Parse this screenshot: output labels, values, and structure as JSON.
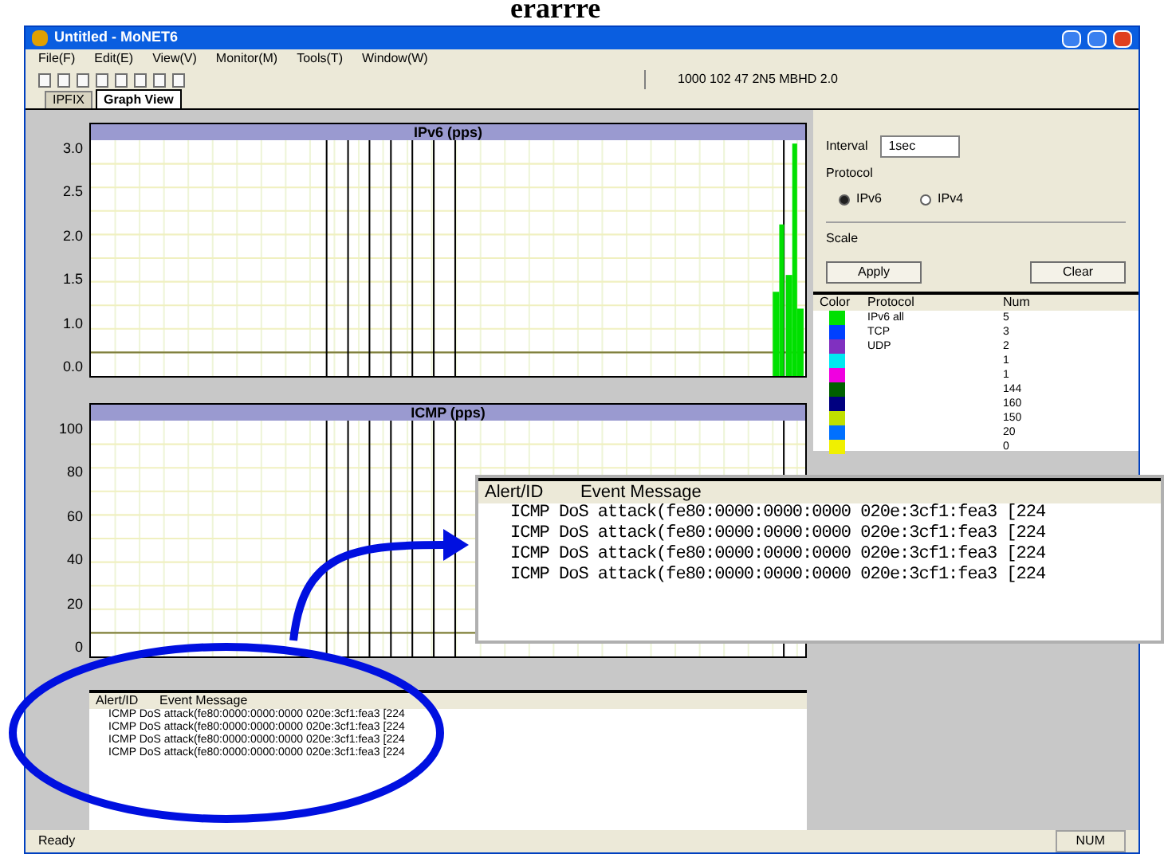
{
  "heading": "erarrre",
  "window": {
    "title": "Untitled - MoNET6"
  },
  "menu": [
    "File(F)",
    "Edit(E)",
    "View(V)",
    "Monitor(M)",
    "Tools(T)",
    "Window(W)"
  ],
  "toolbar": {
    "status_text": "1000  102  47  2N5  MBHD  2.0"
  },
  "tabs": [
    {
      "label": "IPFIX",
      "selected": false
    },
    {
      "label": "Graph View",
      "selected": true
    }
  ],
  "charts": [
    {
      "title": "IPv6 (pps)",
      "y_labels": [
        "3.0",
        "2.5",
        "2.0",
        "1.5",
        "1.0",
        "0.0"
      ],
      "burst": true
    },
    {
      "title": "ICMP (pps)",
      "y_labels": [
        "100",
        "80",
        "60",
        "40",
        "20",
        "0"
      ],
      "burst": false
    }
  ],
  "settings": {
    "interval_label": "Interval",
    "interval_value": "1sec",
    "protocol_label": "Protocol",
    "radios": [
      {
        "label": "IPv6",
        "selected": true
      },
      {
        "label": "IPv4",
        "selected": false
      }
    ],
    "scale_label": "Scale",
    "buttons": [
      "Apply",
      "Clear"
    ]
  },
  "legend": {
    "columns": [
      "Color",
      "Protocol",
      "Num"
    ],
    "rows": [
      {
        "color": "#00e000",
        "protocol": "IPv6 all",
        "num": "5"
      },
      {
        "color": "#0040ff",
        "protocol": "TCP",
        "num": "3"
      },
      {
        "color": "#8030c0",
        "protocol": "UDP",
        "num": "2"
      },
      {
        "color": "#00e8f0",
        "protocol": "",
        "num": "1"
      },
      {
        "color": "#f000e0",
        "protocol": "",
        "num": "1"
      },
      {
        "color": "#006000",
        "protocol": "",
        "num": "144"
      },
      {
        "color": "#000080",
        "protocol": "",
        "num": "160"
      },
      {
        "color": "#c0e000",
        "protocol": "",
        "num": "150"
      },
      {
        "color": "#0070ff",
        "protocol": "",
        "num": "20"
      },
      {
        "color": "#f0f000",
        "protocol": "",
        "num": "0"
      }
    ]
  },
  "event_list": {
    "columns": [
      "Alert/ID",
      "Event Message"
    ],
    "rows": [
      "ICMP DoS attack(fe80:0000:0000:0000 020e:3cf1:fea3 [224",
      "ICMP DoS attack(fe80:0000:0000:0000 020e:3cf1:fea3 [224",
      "ICMP DoS attack(fe80:0000:0000:0000 020e:3cf1:fea3 [224",
      "ICMP DoS attack(fe80:0000:0000:0000 020e:3cf1:fea3 [224"
    ]
  },
  "zoom_popup": {
    "columns": [
      "Alert/ID",
      "Event Message"
    ],
    "rows": [
      "ICMP DoS attack(fe80:0000:0000:0000 020e:3cf1:fea3 [224",
      "ICMP DoS attack(fe80:0000:0000:0000 020e:3cf1:fea3 [224",
      "ICMP DoS attack(fe80:0000:0000:0000 020e:3cf1:fea3 [224",
      "ICMP DoS attack(fe80:0000:0000:0000 020e:3cf1:fea3 [224"
    ]
  },
  "status_bar": {
    "left": "Ready",
    "right": "NUM"
  }
}
